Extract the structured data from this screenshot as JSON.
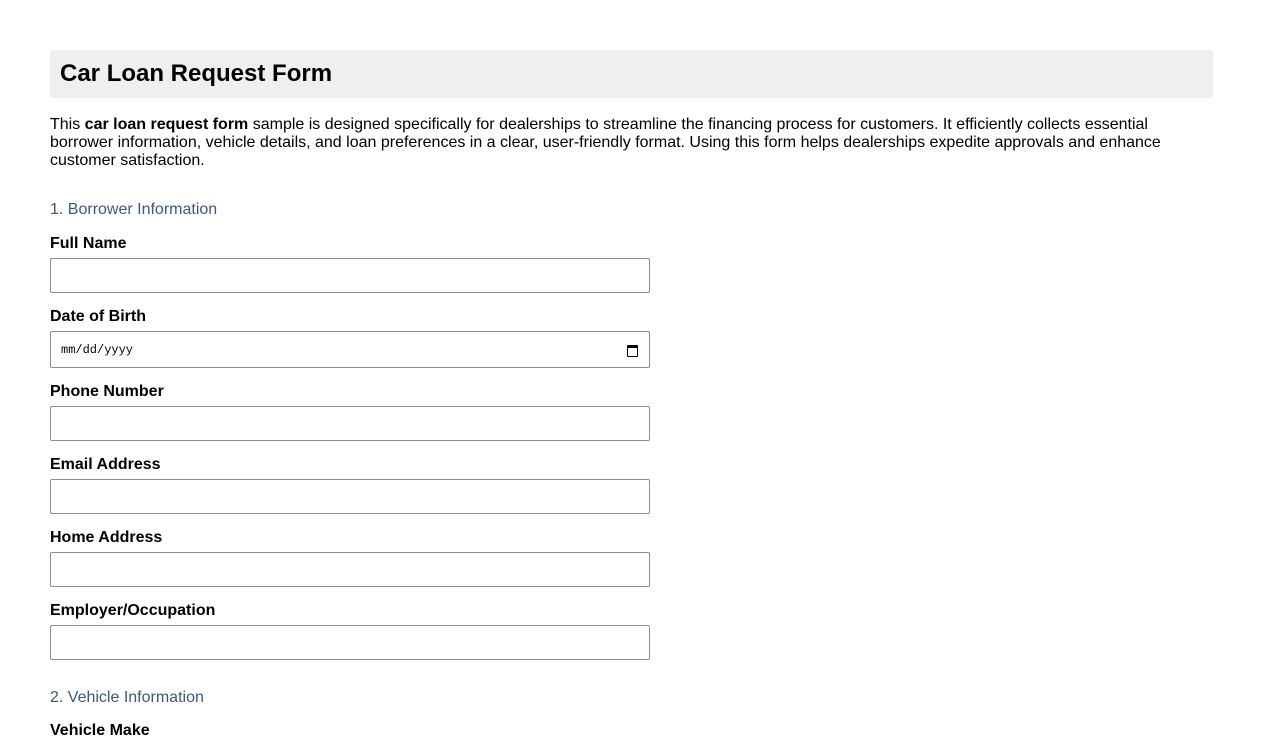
{
  "form": {
    "title": "Car Loan Request Form",
    "intro_before": "This ",
    "intro_bold": "car loan request form",
    "intro_after": " sample is designed specifically for dealerships to streamline the financing process for customers. It efficiently collects essential borrower information, vehicle details, and loan preferences in a clear, user-friendly format. Using this form helps dealerships expedite approvals and enhance customer satisfaction."
  },
  "sections": {
    "borrower": {
      "heading": "1. Borrower Information",
      "full_name_label": "Full Name",
      "dob_label": "Date of Birth",
      "dob_placeholder": "mm/dd/yyyy",
      "phone_label": "Phone Number",
      "email_label": "Email Address",
      "home_address_label": "Home Address",
      "employer_label": "Employer/Occupation"
    },
    "vehicle": {
      "heading": "2. Vehicle Information",
      "make_label": "Vehicle Make"
    }
  },
  "colors": {
    "section_heading": "#3a5a7a",
    "title_bar_bg": "#efefef"
  }
}
